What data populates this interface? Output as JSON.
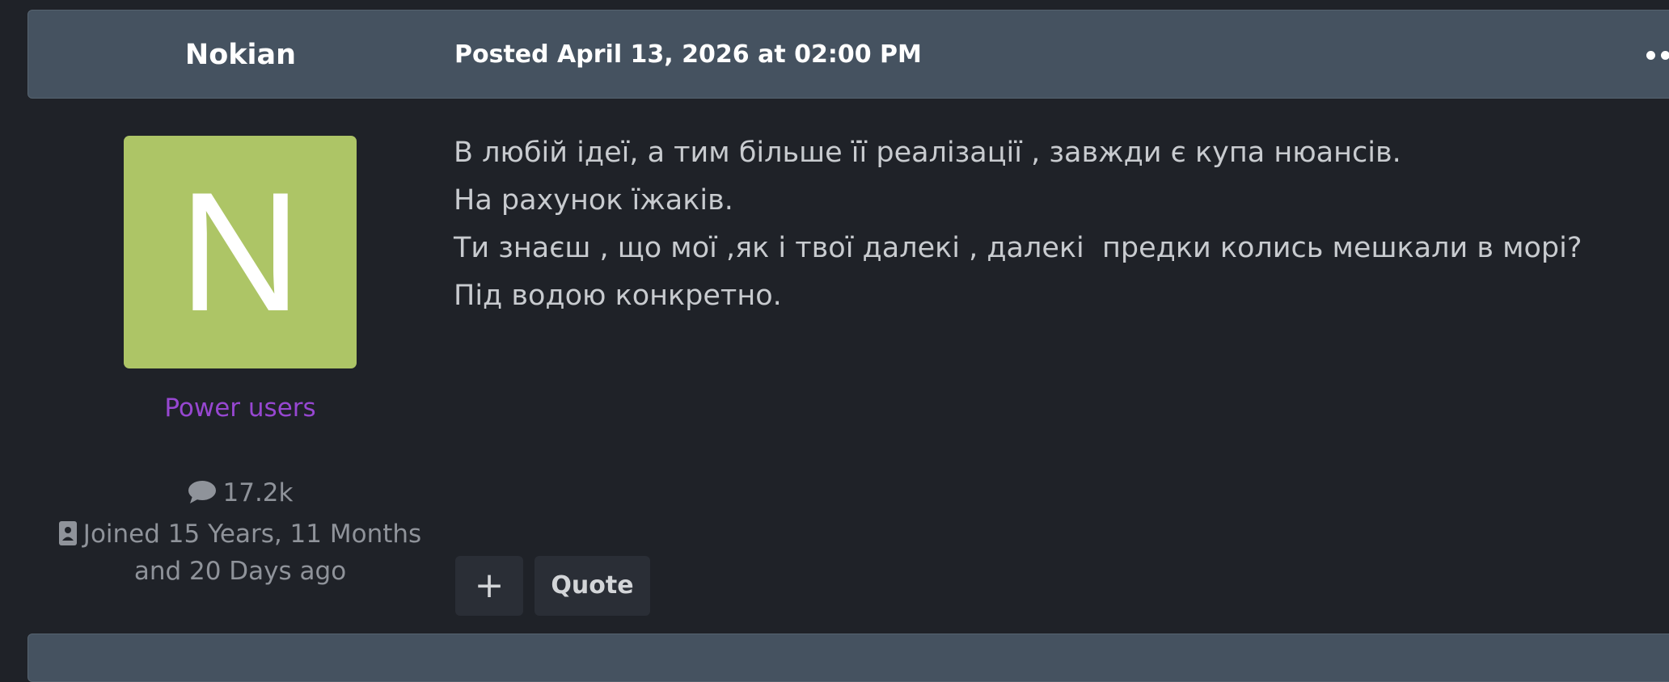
{
  "post": {
    "author": "Nokian",
    "posted": "Posted April 13, 2026 at 02:00 PM",
    "avatar_letter": "N",
    "avatar_color": "#adc566",
    "group": "Power users",
    "group_color": "#9747d1",
    "posts_count": "17.2k",
    "joined": "Joined 15 Years, 11 Months and 20 Days ago",
    "body_lines": [
      "В любій ідеї, а тим більше її реалізації , завжди є купа нюансів.",
      "На рахунок їжаків.",
      "Ти знаєш , що мої ,як і твої далекі , далекі  предки колись мешкали в морі?",
      "Під водою конкретно."
    ],
    "buttons": {
      "plus": "+",
      "quote": "Quote"
    }
  }
}
